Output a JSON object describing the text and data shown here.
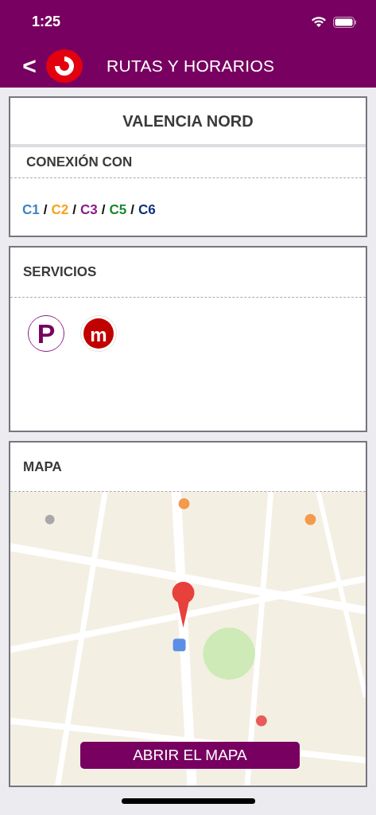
{
  "status_bar": {
    "time": "1:25"
  },
  "header": {
    "back": "<",
    "title": "RUTAS Y HORARIOS"
  },
  "station": {
    "name": "VALENCIA NORD"
  },
  "connections": {
    "title": "CONEXIÓN CON",
    "separator": "/",
    "lines": [
      {
        "label": "C1",
        "color": "#3f82c4"
      },
      {
        "label": "C2",
        "color": "#f7a21b"
      },
      {
        "label": "C3",
        "color": "#8a1c86"
      },
      {
        "label": "C5",
        "color": "#17872f"
      },
      {
        "label": "C6",
        "color": "#0d2f7e"
      }
    ]
  },
  "services": {
    "title": "SERVICIOS",
    "items": [
      {
        "kind": "parking",
        "label": "P"
      },
      {
        "kind": "metro",
        "label": "m"
      }
    ]
  },
  "map": {
    "title": "MAPA",
    "kind": "picture",
    "button": "ABRIR EL MAPA"
  }
}
